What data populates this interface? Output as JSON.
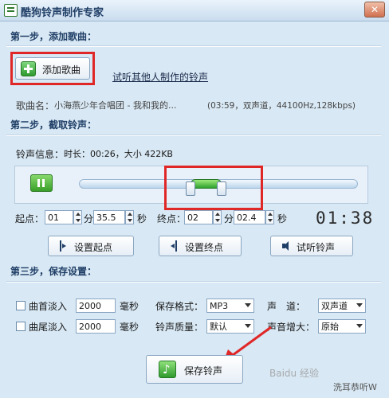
{
  "window": {
    "title": "酷狗铃声制作专家",
    "close_glyph": "✕"
  },
  "step1": {
    "title": "第一步，添加歌曲：",
    "add_button": "添加歌曲",
    "others_link": "试听其他人制作的铃声",
    "song_label": "歌曲名：",
    "song_name": "小海燕少年合唱团 - 我和我的...",
    "song_info": "(03:59，双声道，44100Hz,128kbps)"
  },
  "step2": {
    "title": "第二步，截取铃声：",
    "ring_info_label": "铃声信息：",
    "ring_info": "时长：00:26，大小 422KB",
    "start_label": "起点：",
    "start_min": "01",
    "min_unit": "分",
    "start_sec": "35.5",
    "sec_unit": "秒",
    "end_label": "终点：",
    "end_min": "02",
    "end_sec": "02.4",
    "time_display": "01:38",
    "set_start_button": "设置起点",
    "set_end_button": "设置终点",
    "preview_button": "试听铃声",
    "selection_fraction_start": 0.4,
    "selection_fraction_end": 0.51
  },
  "step3": {
    "title": "第三步，保存设置：",
    "fade_in_label": "曲首淡入",
    "fade_in_value": "2000",
    "fade_out_label": "曲尾淡入",
    "fade_out_value": "2000",
    "ms_unit": "毫秒",
    "format_label": "保存格式：",
    "format_value": "MP3",
    "quality_label": "铃声质量：",
    "quality_value": "默认",
    "channel_label": "声　道：",
    "channel_value": "双声道",
    "gain_label": "声音增大：",
    "gain_value": "原始",
    "save_button": "保存铃声"
  },
  "watermark": {
    "brand": "Baidu 经验",
    "author": "洗耳恭听W"
  },
  "colors": {
    "accent_green": "#3fae3f",
    "highlight_red": "#e02727",
    "title_blue": "#1f3e66"
  }
}
